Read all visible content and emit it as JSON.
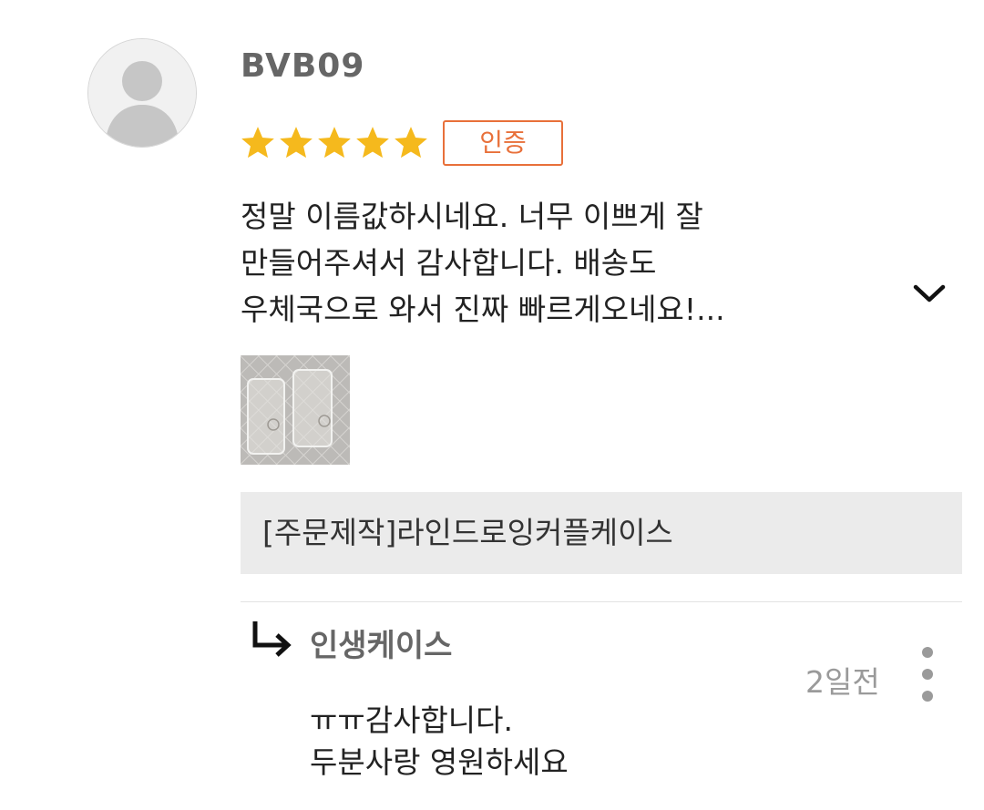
{
  "review": {
    "username": "BVB09",
    "rating": 5,
    "rating_max": 5,
    "badge_label": "인증",
    "text_lines": [
      "정말 이름값하시네요. 너무 이쁘게 잘",
      "만들어주셔서 감사합니다. 배송도",
      "우체국으로 와서 진짜 빠르게오네요!..."
    ],
    "product_name": "[주문제작]라인드로잉커플케이스"
  },
  "reply": {
    "seller_name": "인생케이스",
    "time": "2일전",
    "text_lines": [
      "ㅠㅠ감사합니다.",
      "두분사랑 영원하세요"
    ]
  },
  "icons": {
    "avatar": "default-user-avatar-icon",
    "star": "star-filled-icon",
    "expand": "chevron-down-icon",
    "reply": "reply-arrow-icon",
    "more": "more-vertical-icon"
  },
  "colors": {
    "star": "#f5b91d",
    "badge": "#e8703a",
    "muted_text": "#9a9a9a",
    "product_bg": "#ebebeb"
  }
}
